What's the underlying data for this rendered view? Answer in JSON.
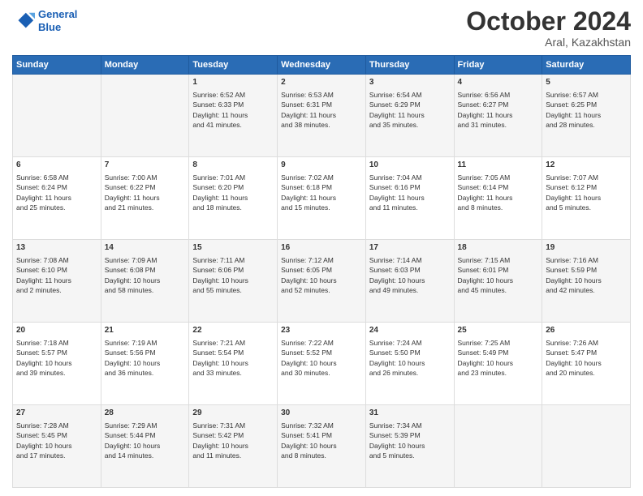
{
  "logo": {
    "line1": "General",
    "line2": "Blue"
  },
  "header": {
    "month": "October 2024",
    "location": "Aral, Kazakhstan"
  },
  "weekdays": [
    "Sunday",
    "Monday",
    "Tuesday",
    "Wednesday",
    "Thursday",
    "Friday",
    "Saturday"
  ],
  "weeks": [
    [
      {
        "day": "",
        "info": ""
      },
      {
        "day": "",
        "info": ""
      },
      {
        "day": "1",
        "info": "Sunrise: 6:52 AM\nSunset: 6:33 PM\nDaylight: 11 hours\nand 41 minutes."
      },
      {
        "day": "2",
        "info": "Sunrise: 6:53 AM\nSunset: 6:31 PM\nDaylight: 11 hours\nand 38 minutes."
      },
      {
        "day": "3",
        "info": "Sunrise: 6:54 AM\nSunset: 6:29 PM\nDaylight: 11 hours\nand 35 minutes."
      },
      {
        "day": "4",
        "info": "Sunrise: 6:56 AM\nSunset: 6:27 PM\nDaylight: 11 hours\nand 31 minutes."
      },
      {
        "day": "5",
        "info": "Sunrise: 6:57 AM\nSunset: 6:25 PM\nDaylight: 11 hours\nand 28 minutes."
      }
    ],
    [
      {
        "day": "6",
        "info": "Sunrise: 6:58 AM\nSunset: 6:24 PM\nDaylight: 11 hours\nand 25 minutes."
      },
      {
        "day": "7",
        "info": "Sunrise: 7:00 AM\nSunset: 6:22 PM\nDaylight: 11 hours\nand 21 minutes."
      },
      {
        "day": "8",
        "info": "Sunrise: 7:01 AM\nSunset: 6:20 PM\nDaylight: 11 hours\nand 18 minutes."
      },
      {
        "day": "9",
        "info": "Sunrise: 7:02 AM\nSunset: 6:18 PM\nDaylight: 11 hours\nand 15 minutes."
      },
      {
        "day": "10",
        "info": "Sunrise: 7:04 AM\nSunset: 6:16 PM\nDaylight: 11 hours\nand 11 minutes."
      },
      {
        "day": "11",
        "info": "Sunrise: 7:05 AM\nSunset: 6:14 PM\nDaylight: 11 hours\nand 8 minutes."
      },
      {
        "day": "12",
        "info": "Sunrise: 7:07 AM\nSunset: 6:12 PM\nDaylight: 11 hours\nand 5 minutes."
      }
    ],
    [
      {
        "day": "13",
        "info": "Sunrise: 7:08 AM\nSunset: 6:10 PM\nDaylight: 11 hours\nand 2 minutes."
      },
      {
        "day": "14",
        "info": "Sunrise: 7:09 AM\nSunset: 6:08 PM\nDaylight: 10 hours\nand 58 minutes."
      },
      {
        "day": "15",
        "info": "Sunrise: 7:11 AM\nSunset: 6:06 PM\nDaylight: 10 hours\nand 55 minutes."
      },
      {
        "day": "16",
        "info": "Sunrise: 7:12 AM\nSunset: 6:05 PM\nDaylight: 10 hours\nand 52 minutes."
      },
      {
        "day": "17",
        "info": "Sunrise: 7:14 AM\nSunset: 6:03 PM\nDaylight: 10 hours\nand 49 minutes."
      },
      {
        "day": "18",
        "info": "Sunrise: 7:15 AM\nSunset: 6:01 PM\nDaylight: 10 hours\nand 45 minutes."
      },
      {
        "day": "19",
        "info": "Sunrise: 7:16 AM\nSunset: 5:59 PM\nDaylight: 10 hours\nand 42 minutes."
      }
    ],
    [
      {
        "day": "20",
        "info": "Sunrise: 7:18 AM\nSunset: 5:57 PM\nDaylight: 10 hours\nand 39 minutes."
      },
      {
        "day": "21",
        "info": "Sunrise: 7:19 AM\nSunset: 5:56 PM\nDaylight: 10 hours\nand 36 minutes."
      },
      {
        "day": "22",
        "info": "Sunrise: 7:21 AM\nSunset: 5:54 PM\nDaylight: 10 hours\nand 33 minutes."
      },
      {
        "day": "23",
        "info": "Sunrise: 7:22 AM\nSunset: 5:52 PM\nDaylight: 10 hours\nand 30 minutes."
      },
      {
        "day": "24",
        "info": "Sunrise: 7:24 AM\nSunset: 5:50 PM\nDaylight: 10 hours\nand 26 minutes."
      },
      {
        "day": "25",
        "info": "Sunrise: 7:25 AM\nSunset: 5:49 PM\nDaylight: 10 hours\nand 23 minutes."
      },
      {
        "day": "26",
        "info": "Sunrise: 7:26 AM\nSunset: 5:47 PM\nDaylight: 10 hours\nand 20 minutes."
      }
    ],
    [
      {
        "day": "27",
        "info": "Sunrise: 7:28 AM\nSunset: 5:45 PM\nDaylight: 10 hours\nand 17 minutes."
      },
      {
        "day": "28",
        "info": "Sunrise: 7:29 AM\nSunset: 5:44 PM\nDaylight: 10 hours\nand 14 minutes."
      },
      {
        "day": "29",
        "info": "Sunrise: 7:31 AM\nSunset: 5:42 PM\nDaylight: 10 hours\nand 11 minutes."
      },
      {
        "day": "30",
        "info": "Sunrise: 7:32 AM\nSunset: 5:41 PM\nDaylight: 10 hours\nand 8 minutes."
      },
      {
        "day": "31",
        "info": "Sunrise: 7:34 AM\nSunset: 5:39 PM\nDaylight: 10 hours\nand 5 minutes."
      },
      {
        "day": "",
        "info": ""
      },
      {
        "day": "",
        "info": ""
      }
    ]
  ]
}
